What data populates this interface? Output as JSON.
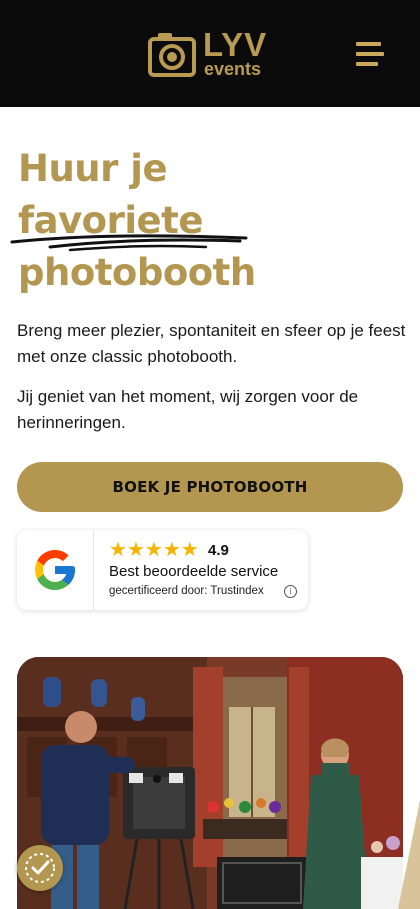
{
  "header": {
    "brand_main": "LYV",
    "brand_sub": "events",
    "menu_icon": "hamburger-icon"
  },
  "hero": {
    "title_lines": [
      "Huur je",
      "favoriete",
      "photobooth"
    ],
    "paragraph_1": "Breng meer plezier, spontaniteit en sfeer op je feest met onze classic photobooth.",
    "paragraph_2": "Jij geniet van het moment, wij zorgen voor de herinneringen.",
    "cta_label": "BOEK JE PHOTOBOOTH"
  },
  "review_widget": {
    "stars": 5,
    "rating": "4.9",
    "title": "Best beoordeelde service",
    "certified": "gecertificeerd door: Trustindex",
    "logo_icon": "google-icon",
    "info_icon": "info-icon"
  },
  "colors": {
    "header_bg": "#0b0b0b",
    "gold": "#b3964f",
    "star": "#f5b400"
  },
  "photo": {
    "icon": "photobooth-event-photo"
  },
  "floating_badge": {
    "icon": "accessibility-icon"
  }
}
